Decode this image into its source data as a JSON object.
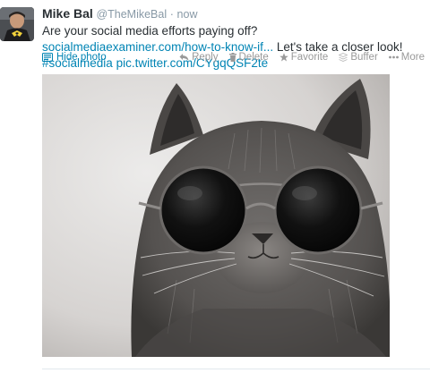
{
  "tweet": {
    "fullname": "Mike Bal",
    "username": "@TheMikeBal",
    "separator": "·",
    "time": "now",
    "text_part1": "Are your social media efforts paying off? ",
    "link_url": "socialmediaexaminer.com/how-to-know-if...",
    "text_part2": " Let's take a closer look! ",
    "hashtag": "#socialmedia",
    "text_space": " ",
    "pic_link": "pic.twitter.com/CYgqQSF2te"
  },
  "actions": {
    "hide_photo": "Hide photo",
    "reply": "Reply",
    "delete": "Delete",
    "favorite": "Favorite",
    "buffer": "Buffer",
    "more": "More"
  },
  "icons": {
    "photo": "photo-icon",
    "reply": "reply-icon",
    "delete": "trash-icon",
    "favorite": "star-icon",
    "buffer": "buffer-icon",
    "more": "more-dots-icon"
  },
  "colors": {
    "link": "#0084b4",
    "text": "#292f33",
    "meta": "#8899a6",
    "action": "#999999"
  }
}
